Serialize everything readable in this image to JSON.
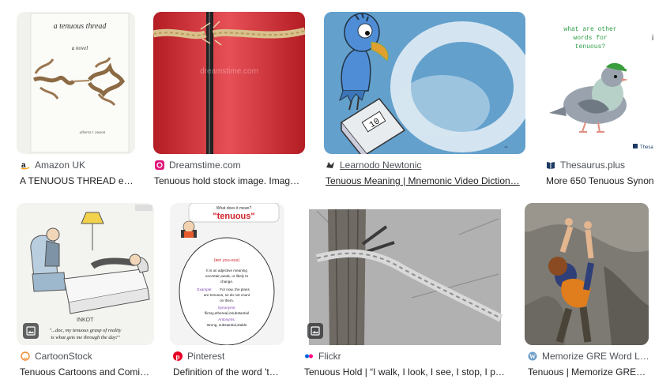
{
  "results": [
    {
      "source": "Amazon UK",
      "caption": "A TENUOUS THREAD eB…",
      "fav_icon": "amazon-icon",
      "book_title": "a tenuous thread",
      "book_sub": "a novel",
      "book_author": "alberta t. mason"
    },
    {
      "source": "Dreamstime.com",
      "caption": "Tenuous hold stock image. Imag…",
      "fav_icon": "dreamstime-icon",
      "watermark": "dreamstime.com"
    },
    {
      "source": "Learnodo Newtonic",
      "caption": "Tenuous Meaning | Mnemonic Video Diction…",
      "fav_icon": "learnodo-icon",
      "scale_reading": "10"
    },
    {
      "source": "Thesaurus.plus",
      "caption": "More 650 Tenuous Synon…",
      "fav_icon": "thesaurus-icon",
      "bubble_text": [
        "what are other",
        "words for",
        "tenuous?"
      ],
      "corner_brand": "Thesa"
    },
    {
      "source": "CartoonStock",
      "caption": "Tenuous Cartoons and Comi…",
      "fav_icon": "cartoonstock-icon",
      "cartoon_caption": [
        "\"...doc, my tenuous grasp of reality",
        "is what gets me through the day!\""
      ],
      "artist": "INKOT"
    },
    {
      "source": "Pinterest",
      "caption": "Definition of the word 't…",
      "fav_icon": "pinterest-icon",
      "card_head": "What does it mean?",
      "card_word": "\"tenuous\"",
      "card_pron": "(ten you-ous)",
      "card_def": [
        "It is an adjective meaning",
        "uncertain,weak, or likely to",
        "change."
      ],
      "card_example_label": "Example:",
      "card_example": [
        "For now, the plans",
        "are tenuous, so do not count",
        "on them."
      ],
      "card_syn_label": "Synonyms:",
      "card_syn": "flimsy,ethereal,insubstantial",
      "card_ant_label": "Antonyms:",
      "card_ant": "strong, substantial,stable"
    },
    {
      "source": "Flickr",
      "caption": "Tenuous Hold | “I walk, I look, I see, I stop, I p…",
      "fav_icon": "flickr-icon"
    },
    {
      "source": "Memorize GRE Word L…",
      "caption": "Tenuous | Memorize GRE…",
      "fav_icon": "wordpress-icon"
    }
  ],
  "colors": {
    "accent": "#1a73e8",
    "text": "#202124",
    "muted": "#4d5156",
    "red": "#e0242c",
    "sky": "#7fb0d6"
  }
}
